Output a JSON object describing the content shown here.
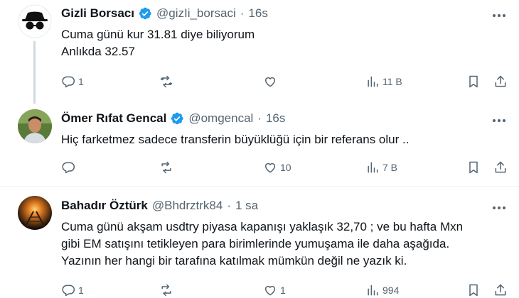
{
  "tweets": [
    {
      "name": "Gizli Borsacı",
      "handle": "@gizIi_borsaci",
      "separator": "·",
      "time": "16s",
      "lines": [
        "Cuma günü kur 31.81 diye biliyorum",
        "Anlıkda 32.57"
      ],
      "replies": "1",
      "retweets": "",
      "likes": "",
      "views": "11 B",
      "verified": true
    },
    {
      "name": "Ömer Rıfat Gencal",
      "handle": "@omgencal",
      "separator": "·",
      "time": "16s",
      "lines": [
        "Hiç farketmez sadece transferin büyüklüğü için bir referans olur .."
      ],
      "replies": "",
      "retweets": "",
      "likes": "10",
      "views": "7 B",
      "verified": true
    },
    {
      "name": "Bahadır Öztürk",
      "handle": "@Bhdrztrk84",
      "separator": "·",
      "time": "1 sa",
      "lines": [
        "Cuma günü akşam usdtry piyasa kapanışı yaklaşık 32,70 ; ve bu hafta Mxn",
        "gibi EM satışını tetikleyen para birimlerinde yumuşama ile daha aşağıda.",
        "Yazının her hangi bir tarafına katılmak mümkün değil ne yazık ki."
      ],
      "replies": "1",
      "retweets": "",
      "likes": "1",
      "views": "994",
      "verified": false
    }
  ],
  "colors": {
    "verified_badge": "#1d9bf0",
    "secondary_text": "#536471",
    "primary_text": "#0f1419",
    "thread_line": "#cfd9de"
  },
  "icons": [
    "reply-icon",
    "retweet-icon",
    "like-icon",
    "views-icon",
    "bookmark-icon",
    "share-icon",
    "verified-icon",
    "more-icon"
  ]
}
